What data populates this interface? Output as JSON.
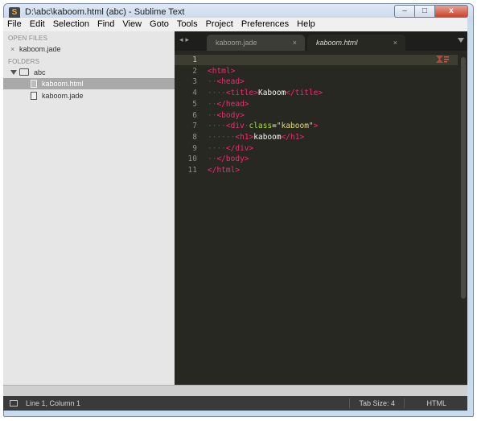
{
  "window": {
    "title": "D:\\abc\\kaboom.html (abc) - Sublime Text",
    "minimize_glyph": "–",
    "maximize_glyph": "□",
    "close_glyph": "x"
  },
  "menu": [
    "File",
    "Edit",
    "Selection",
    "Find",
    "View",
    "Goto",
    "Tools",
    "Project",
    "Preferences",
    "Help"
  ],
  "sidebar": {
    "open_files_header": "OPEN FILES",
    "open_files": [
      {
        "name": "kaboom.jade",
        "close_glyph": "×"
      }
    ],
    "folders_header": "FOLDERS",
    "folder": {
      "name": "abc"
    },
    "files": [
      {
        "name": "kaboom.html",
        "selected": true
      },
      {
        "name": "kaboom.jade",
        "selected": false
      }
    ]
  },
  "tabs": {
    "nav_glyph": "◂▸",
    "items": [
      {
        "label": "kaboom.jade",
        "active": false,
        "close_glyph": "×"
      },
      {
        "label": "kaboom.html",
        "active": true,
        "close_glyph": "×"
      }
    ]
  },
  "editor": {
    "current_line": 1,
    "line_numbers": [
      "1",
      "2",
      "3",
      "4",
      "5",
      "6",
      "7",
      "8",
      "9",
      "10",
      "11"
    ],
    "lines": [
      {
        "ws": "",
        "parts": []
      },
      {
        "ws": "",
        "parts": [
          [
            "tag",
            "<"
          ],
          [
            "tag",
            "html"
          ],
          [
            "tag",
            ">"
          ]
        ]
      },
      {
        "ws": "··",
        "parts": [
          [
            "tag",
            "<"
          ],
          [
            "tag",
            "head"
          ],
          [
            "tag",
            ">"
          ]
        ]
      },
      {
        "ws": "····",
        "parts": [
          [
            "tag",
            "<"
          ],
          [
            "tag",
            "title"
          ],
          [
            "tag",
            ">"
          ],
          [
            "text",
            "Kaboom"
          ],
          [
            "tag",
            "</"
          ],
          [
            "tag",
            "title"
          ],
          [
            "tag",
            ">"
          ]
        ]
      },
      {
        "ws": "··",
        "parts": [
          [
            "tag",
            "</"
          ],
          [
            "tag",
            "head"
          ],
          [
            "tag",
            ">"
          ]
        ]
      },
      {
        "ws": "··",
        "parts": [
          [
            "tag",
            "<"
          ],
          [
            "tag",
            "body"
          ],
          [
            "tag",
            ">"
          ]
        ]
      },
      {
        "ws": "····",
        "parts": [
          [
            "tag",
            "<"
          ],
          [
            "tag",
            "div"
          ],
          [
            "ws",
            "·"
          ],
          [
            "attr",
            "class"
          ],
          [
            "text",
            "="
          ],
          [
            "str",
            "\"kaboom\""
          ],
          [
            "tag",
            ">"
          ]
        ]
      },
      {
        "ws": "······",
        "parts": [
          [
            "tag",
            "<"
          ],
          [
            "tag",
            "h1"
          ],
          [
            "tag",
            ">"
          ],
          [
            "text",
            "kaboom"
          ],
          [
            "tag",
            "</"
          ],
          [
            "tag",
            "h1"
          ],
          [
            "tag",
            ">"
          ]
        ]
      },
      {
        "ws": "····",
        "parts": [
          [
            "tag",
            "</"
          ],
          [
            "tag",
            "div"
          ],
          [
            "tag",
            ">"
          ]
        ]
      },
      {
        "ws": "··",
        "parts": [
          [
            "tag",
            "</"
          ],
          [
            "tag",
            "body"
          ],
          [
            "tag",
            ">"
          ]
        ]
      },
      {
        "ws": "",
        "parts": [
          [
            "tag",
            "</"
          ],
          [
            "tag",
            "html"
          ],
          [
            "tag",
            ">"
          ]
        ]
      }
    ]
  },
  "status": {
    "position": "Line 1, Column 1",
    "tab_size": "Tab Size: 4",
    "syntax": "HTML"
  },
  "colors": {
    "editor_bg": "#272822",
    "tag": "#f92672",
    "attr": "#a6e22e",
    "string": "#e6db74",
    "text": "#f8f8f2",
    "line_number": "#8f908a"
  }
}
